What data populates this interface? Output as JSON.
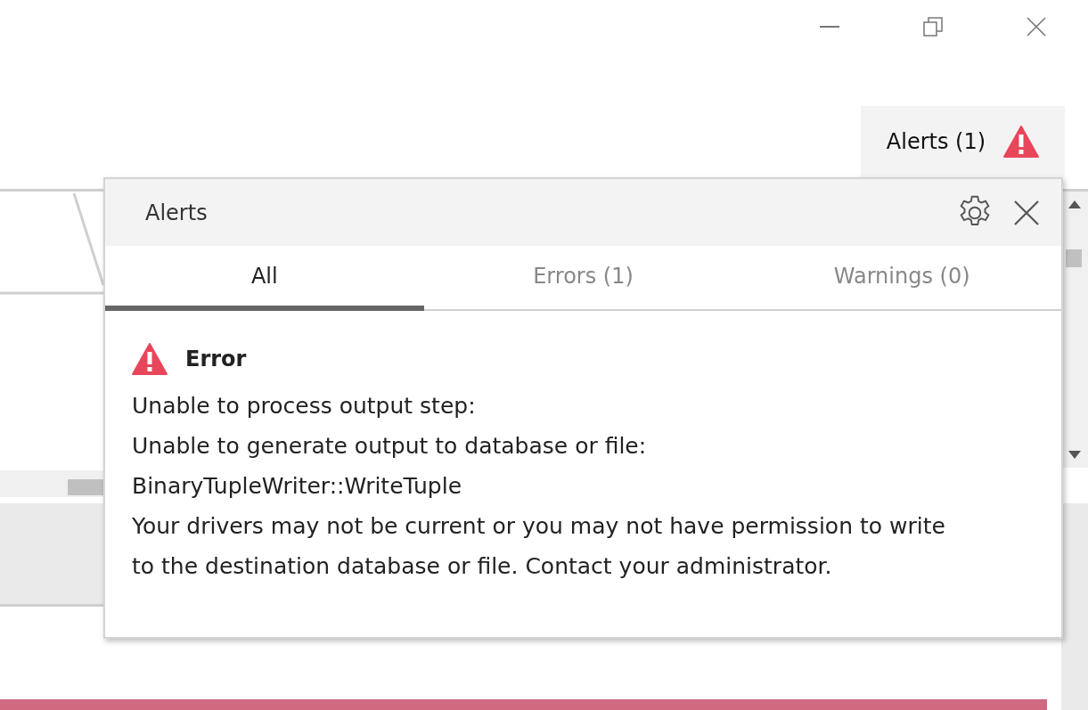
{
  "toolbar": {
    "alerts_button": "Alerts (1)"
  },
  "alerts_panel": {
    "title": "Alerts",
    "tabs": [
      {
        "label": "All",
        "selected": true
      },
      {
        "label": "Errors (1)",
        "selected": false
      },
      {
        "label": "Warnings (0)",
        "selected": false
      }
    ],
    "alerts": [
      {
        "kind": "error",
        "title": "Error",
        "lines": [
          "Unable to process output step:",
          "Unable to generate output to database or file:",
          "BinaryTupleWriter::WriteTuple",
          "Your drivers may not be current or you may not have permission to write to the destination database or file. Contact your administrator."
        ]
      }
    ]
  }
}
